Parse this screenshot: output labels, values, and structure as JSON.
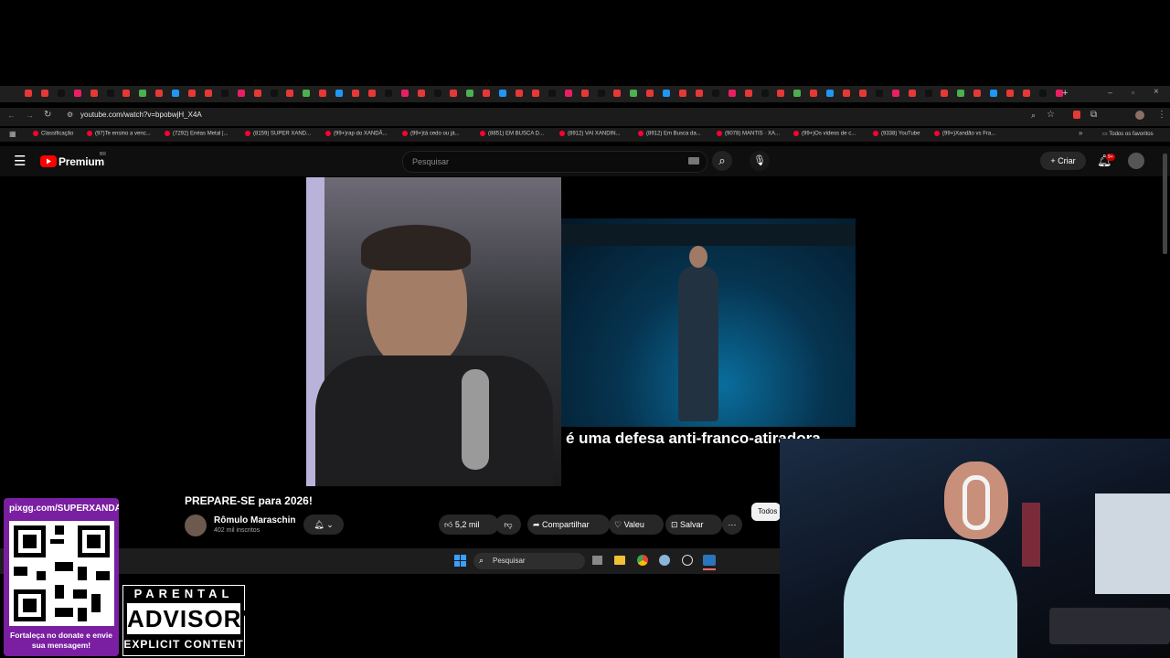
{
  "browser": {
    "url": "youtube.com/watch?v=bpobwjH_X4A",
    "bookmarks": [
      "Classificação",
      "(97)Te ensino a venc...",
      "(7292) Enéas Metal |...",
      "(8159) SUPER XAND...",
      "(99+)rap do XANDÃ...",
      "(99+)tá cedo ou já...",
      "(8851) EM BUSCA D...",
      "(8912) VAI XANDIN...",
      "(8912) Em Busca da...",
      "(9078) MANTIS · XA...",
      "(99+)Os vídeos de c...",
      "(9338) YouTube",
      "(99+)Xandão vs Fra..."
    ],
    "all_bookmarks_label": "Todos os favoritos"
  },
  "youtube": {
    "logo": "Premium",
    "logo_country": "BR",
    "search_placeholder": "Pesquisar",
    "create_label": "Criar",
    "notifications_badge": "9+"
  },
  "video": {
    "subtitle": "é uma defesa anti-franco-atiradora",
    "title": "PREPARE-SE para 2026!",
    "channel_name": "Rômulo Maraschin",
    "subscribers": "402 mil inscritos",
    "likes": "5,2 mil",
    "share_label": "Compartilhar",
    "thanks_label": "Valeu",
    "save_label": "Salvar",
    "filter_chip": "Todos"
  },
  "taskbar": {
    "search_placeholder": "Pesquisar"
  },
  "overlay": {
    "donate_url": "pixgg.com/SUPERXANDÃO",
    "donate_message": "Fortaleça no donate e envie sua mensagem!",
    "advisory_top": "PARENTAL",
    "advisory_mid": "ADVISORY",
    "advisory_bottom": "EXPLICIT CONTENT"
  },
  "colors": {
    "youtube_red": "#ff0000",
    "page_bg": "#0f0f0f",
    "donate_panel": "#7a1fa2"
  }
}
